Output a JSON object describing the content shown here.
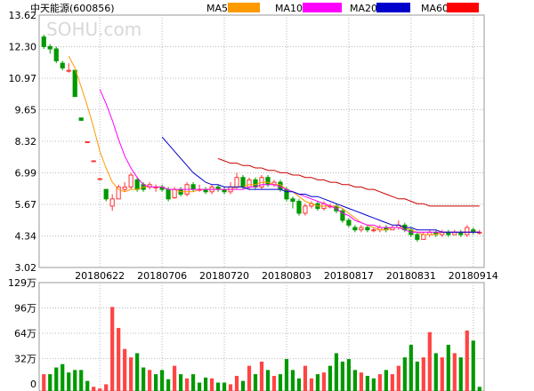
{
  "header": {
    "title": "中天能源(600856)",
    "watermark": "SOHU.com",
    "legend": [
      {
        "label": "MA5",
        "color": "#ff9900"
      },
      {
        "label": "MA10",
        "color": "#ff00ff"
      },
      {
        "label": "MA20",
        "color": "#0000cc"
      },
      {
        "label": "MA60",
        "color": "#ff0000"
      }
    ]
  },
  "chart_data": [
    {
      "type": "candlestick",
      "title": "中天能源(600856)",
      "ylim": [
        3.02,
        13.62
      ],
      "y_ticks": [
        "13.62",
        "12.30",
        "10.97",
        "9.65",
        "8.32",
        "6.99",
        "5.67",
        "4.34",
        "3.02"
      ],
      "x_tick_labels": [
        "20180622",
        "20180706",
        "20180720",
        "20180803",
        "20180817",
        "20180831",
        "20180914"
      ],
      "x_tick_index": [
        9,
        19,
        29,
        39,
        49,
        59,
        69
      ],
      "grid": true,
      "up_color": "#ff3333",
      "down_color": "#009900",
      "candles": [
        [
          12.7,
          12.3,
          12.8,
          12.2
        ],
        [
          12.3,
          12.2,
          12.4,
          12.0
        ],
        [
          12.2,
          11.7,
          12.3,
          11.6
        ],
        [
          11.6,
          11.4,
          11.7,
          11.3
        ],
        [
          11.3,
          11.3,
          11.6,
          11.2
        ],
        [
          11.3,
          10.2,
          11.3,
          10.2
        ],
        [
          9.3,
          9.2,
          9.3,
          9.2
        ],
        [
          8.3,
          8.3,
          8.3,
          8.3
        ],
        [
          7.5,
          7.5,
          7.5,
          7.5
        ],
        [
          6.75,
          6.75,
          6.75,
          6.75
        ],
        [
          6.3,
          5.9,
          6.3,
          5.8
        ],
        [
          5.6,
          5.9,
          6.1,
          5.4
        ],
        [
          5.9,
          6.4,
          6.5,
          5.9
        ],
        [
          6.3,
          6.4,
          6.6,
          6.2
        ],
        [
          6.4,
          6.9,
          7.0,
          6.3
        ],
        [
          6.7,
          6.3,
          6.8,
          6.2
        ],
        [
          6.5,
          6.3,
          6.6,
          6.2
        ],
        [
          6.4,
          6.5,
          6.6,
          6.3
        ],
        [
          6.4,
          6.4,
          6.5,
          6.2
        ],
        [
          6.4,
          6.3,
          6.5,
          6.2
        ],
        [
          6.3,
          5.9,
          6.4,
          5.8
        ],
        [
          5.95,
          6.3,
          6.4,
          5.9
        ],
        [
          6.3,
          6.1,
          6.4,
          6.0
        ],
        [
          6.1,
          6.5,
          6.6,
          6.0
        ],
        [
          6.5,
          6.3,
          6.6,
          6.2
        ],
        [
          6.3,
          6.3,
          6.5,
          6.2
        ],
        [
          6.3,
          6.2,
          6.4,
          6.1
        ],
        [
          6.2,
          6.4,
          6.5,
          6.1
        ],
        [
          6.4,
          6.3,
          6.5,
          6.2
        ],
        [
          6.3,
          6.2,
          6.4,
          6.1
        ],
        [
          6.2,
          6.4,
          6.6,
          6.1
        ],
        [
          6.4,
          6.8,
          7.0,
          6.3
        ],
        [
          6.8,
          6.4,
          6.9,
          6.3
        ],
        [
          6.4,
          6.7,
          6.8,
          6.3
        ],
        [
          6.7,
          6.4,
          6.8,
          6.3
        ],
        [
          6.4,
          6.8,
          6.9,
          6.3
        ],
        [
          6.8,
          6.5,
          6.9,
          6.4
        ],
        [
          6.5,
          6.6,
          6.7,
          6.4
        ],
        [
          6.6,
          6.3,
          6.7,
          6.2
        ],
        [
          6.3,
          5.9,
          6.4,
          5.8
        ],
        [
          5.9,
          5.8,
          6.0,
          5.5
        ],
        [
          5.8,
          5.3,
          5.9,
          5.2
        ],
        [
          5.3,
          5.6,
          5.7,
          5.2
        ],
        [
          5.6,
          5.7,
          5.8,
          5.5
        ],
        [
          5.7,
          5.5,
          5.8,
          5.4
        ],
        [
          5.5,
          5.7,
          5.8,
          5.4
        ],
        [
          5.6,
          5.6,
          5.7,
          5.5
        ],
        [
          5.6,
          5.4,
          5.7,
          5.3
        ],
        [
          5.4,
          5.0,
          5.5,
          4.9
        ],
        [
          5.0,
          4.8,
          5.1,
          4.7
        ],
        [
          4.7,
          4.6,
          4.8,
          4.5
        ],
        [
          4.6,
          4.7,
          4.8,
          4.5
        ],
        [
          4.7,
          4.6,
          4.8,
          4.5
        ],
        [
          4.6,
          4.6,
          4.7,
          4.5
        ],
        [
          4.6,
          4.7,
          4.8,
          4.5
        ],
        [
          4.7,
          4.6,
          4.8,
          4.5
        ],
        [
          4.6,
          4.7,
          4.8,
          4.6
        ],
        [
          4.7,
          4.8,
          5.0,
          4.6
        ],
        [
          4.8,
          4.6,
          4.9,
          4.5
        ],
        [
          4.6,
          4.4,
          4.7,
          4.3
        ],
        [
          4.4,
          4.2,
          4.5,
          4.1
        ],
        [
          4.2,
          4.4,
          4.5,
          4.2
        ],
        [
          4.4,
          4.5,
          4.6,
          4.3
        ],
        [
          4.5,
          4.4,
          4.6,
          4.3
        ],
        [
          4.4,
          4.5,
          4.6,
          4.3
        ],
        [
          4.5,
          4.4,
          4.6,
          4.3
        ],
        [
          4.4,
          4.5,
          4.6,
          4.4
        ],
        [
          4.5,
          4.4,
          4.6,
          4.3
        ],
        [
          4.4,
          4.7,
          4.8,
          4.3
        ],
        [
          4.6,
          4.5,
          4.7,
          4.4
        ],
        [
          4.5,
          4.5,
          4.6,
          4.4
        ]
      ],
      "ma": [
        {
          "name": "MA5",
          "color": "#ff9900",
          "values": [
            null,
            null,
            null,
            null,
            11.9,
            11.4,
            10.6,
            9.8,
            8.9,
            7.9,
            7.2,
            6.6,
            6.3,
            6.2,
            6.3,
            6.3,
            6.4,
            6.4,
            6.4,
            6.4,
            6.3,
            6.3,
            6.2,
            6.2,
            6.2,
            6.3,
            6.3,
            6.3,
            6.3,
            6.3,
            6.3,
            6.4,
            6.4,
            6.5,
            6.5,
            6.6,
            6.6,
            6.5,
            6.5,
            6.3,
            6.2,
            6.0,
            5.8,
            5.7,
            5.6,
            5.6,
            5.6,
            5.6,
            5.5,
            5.3,
            5.1,
            4.9,
            4.8,
            4.7,
            4.6,
            4.6,
            4.7,
            4.7,
            4.7,
            4.6,
            4.5,
            4.4,
            4.4,
            4.4,
            4.5,
            4.5,
            4.5,
            4.5,
            4.5,
            4.5,
            4.5
          ]
        },
        {
          "name": "MA10",
          "color": "#ff00ff",
          "values": [
            null,
            null,
            null,
            null,
            null,
            null,
            null,
            null,
            null,
            10.5,
            9.9,
            9.2,
            8.4,
            7.7,
            7.2,
            6.8,
            6.5,
            6.4,
            6.4,
            6.4,
            6.3,
            6.3,
            6.3,
            6.3,
            6.3,
            6.3,
            6.3,
            6.3,
            6.3,
            6.3,
            6.3,
            6.3,
            6.3,
            6.4,
            6.4,
            6.5,
            6.5,
            6.5,
            6.4,
            6.3,
            6.2,
            6.1,
            6.0,
            5.9,
            5.8,
            5.7,
            5.6,
            5.5,
            5.3,
            5.2,
            5.0,
            4.9,
            4.8,
            4.8,
            4.7,
            4.7,
            4.7,
            4.7,
            4.6,
            4.5,
            4.5,
            4.5,
            4.5,
            4.5,
            4.5,
            4.5,
            4.5,
            4.5,
            4.5,
            4.5,
            4.5
          ]
        },
        {
          "name": "MA20",
          "color": "#0000cc",
          "values": [
            null,
            null,
            null,
            null,
            null,
            null,
            null,
            null,
            null,
            null,
            null,
            null,
            null,
            null,
            null,
            null,
            null,
            null,
            null,
            8.5,
            8.2,
            7.9,
            7.6,
            7.3,
            7.0,
            6.8,
            6.6,
            6.5,
            6.5,
            6.4,
            6.4,
            6.4,
            6.4,
            6.3,
            6.3,
            6.3,
            6.3,
            6.3,
            6.3,
            6.2,
            6.2,
            6.1,
            6.1,
            6.0,
            6.0,
            5.9,
            5.8,
            5.7,
            5.6,
            5.5,
            5.4,
            5.3,
            5.2,
            5.1,
            5.0,
            4.9,
            4.8,
            4.8,
            4.7,
            4.7,
            4.6,
            4.6,
            4.6,
            4.6,
            4.5,
            4.5,
            4.5,
            4.5,
            4.5,
            4.5,
            4.5
          ]
        },
        {
          "name": "MA60",
          "color": "#cc0000",
          "values": [
            null,
            null,
            null,
            null,
            null,
            null,
            null,
            null,
            null,
            null,
            null,
            null,
            null,
            null,
            null,
            null,
            null,
            null,
            null,
            null,
            null,
            null,
            null,
            null,
            null,
            null,
            null,
            null,
            7.6,
            7.5,
            7.4,
            7.4,
            7.3,
            7.3,
            7.2,
            7.2,
            7.1,
            7.1,
            7.0,
            7.0,
            6.9,
            6.9,
            6.8,
            6.8,
            6.7,
            6.7,
            6.6,
            6.6,
            6.5,
            6.5,
            6.4,
            6.4,
            6.3,
            6.3,
            6.2,
            6.1,
            6.0,
            5.9,
            5.9,
            5.8,
            5.7,
            5.7,
            5.6,
            5.6,
            5.6,
            5.6,
            5.6,
            5.6,
            5.6,
            5.6,
            5.6
          ]
        }
      ]
    },
    {
      "type": "bar",
      "ylim": [
        0,
        129
      ],
      "y_ticks": [
        "129万",
        "96万",
        "64万",
        "32万",
        "0"
      ],
      "values": [
        20,
        20,
        28,
        32,
        22,
        25,
        25,
        12,
        5,
        3,
        8,
        100,
        75,
        50,
        40,
        45,
        28,
        25,
        20,
        25,
        14,
        30,
        20,
        15,
        20,
        10,
        16,
        15,
        10,
        10,
        8,
        18,
        12,
        30,
        20,
        35,
        25,
        18,
        20,
        38,
        25,
        15,
        30,
        15,
        20,
        22,
        30,
        45,
        35,
        38,
        25,
        22,
        18,
        15,
        20,
        25,
        20,
        30,
        40,
        55,
        35,
        40,
        70,
        45,
        40,
        55,
        45,
        40,
        72,
        60,
        5
      ],
      "colors": [
        "up",
        "down",
        "down",
        "down",
        "down",
        "down",
        "down",
        "down",
        "up",
        "up",
        "up",
        "up",
        "up",
        "up",
        "up",
        "down",
        "down",
        "up",
        "down",
        "down",
        "down",
        "up",
        "down",
        "up",
        "down",
        "down",
        "down",
        "up",
        "down",
        "down",
        "up",
        "up",
        "down",
        "up",
        "down",
        "up",
        "down",
        "up",
        "down",
        "down",
        "down",
        "down",
        "up",
        "up",
        "down",
        "up",
        "down",
        "down",
        "down",
        "down",
        "down",
        "up",
        "down",
        "down",
        "up",
        "down",
        "up",
        "up",
        "down",
        "down",
        "down",
        "up",
        "up",
        "down",
        "up",
        "down",
        "up",
        "down",
        "up",
        "down",
        "down"
      ]
    }
  ]
}
